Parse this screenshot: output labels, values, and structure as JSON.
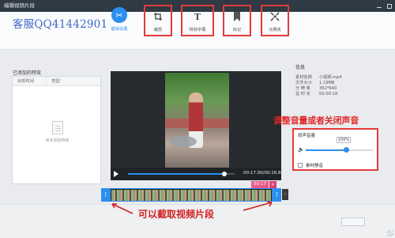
{
  "window": {
    "title": "编辑视频片段"
  },
  "brand": {
    "text": "客服QQ41442901"
  },
  "toolbar": {
    "items": [
      {
        "label": "基础设置",
        "icon": "scissors-icon"
      },
      {
        "label": "裁剪",
        "icon": "crop-icon"
      },
      {
        "label": "特效字幕",
        "icon": "text-icon"
      },
      {
        "label": "标记",
        "icon": "bookmark-icon"
      },
      {
        "label": "马赛克",
        "icon": "mosaic-icon"
      }
    ],
    "active": "基础设置"
  },
  "effects_panel": {
    "title": "已添加的特效",
    "columns": [
      "出现时间",
      "类型"
    ],
    "empty_text": "尚未添加特效"
  },
  "player": {
    "timecode": "00:17.00/00:18.86",
    "progress": 0.9,
    "cut_time": "00:17"
  },
  "info": {
    "title": "信息",
    "rows": [
      {
        "k": "素材名称",
        "v": "小视频.mp4"
      },
      {
        "k": "文件大小",
        "v": "1.19MB"
      },
      {
        "k": "分 辨 率",
        "v": "362*640"
      },
      {
        "k": "总 时 长",
        "v": "00:00:18"
      }
    ]
  },
  "audio": {
    "title": "原声音量",
    "volume_label": "100%",
    "volume": 0.6,
    "mute_label": "素材静音"
  },
  "annotations": {
    "audio_note": "调整音量或者关闭声音",
    "clip_note": "可以截取视频片段"
  },
  "colors": {
    "accent": "#2c8ff0",
    "highlight": "#e23b3b"
  }
}
